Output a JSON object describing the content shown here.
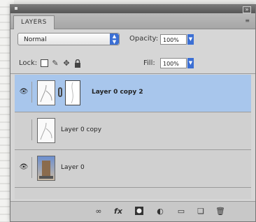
{
  "panel": {
    "tab_label": "LAYERS",
    "menu_icon": "panel-menu-icon"
  },
  "controls": {
    "blend_mode": "Normal",
    "opacity_label": "Opacity:",
    "opacity_value": "100%",
    "lock_label": "Lock:",
    "fill_label": "Fill:",
    "fill_value": "100%"
  },
  "layers": [
    {
      "name": "Layer 0 copy 2",
      "selected": true,
      "visible": true,
      "has_mask": true
    },
    {
      "name": "Layer 0 copy",
      "selected": false,
      "visible": false,
      "has_mask": false
    },
    {
      "name": "Layer 0",
      "selected": false,
      "visible": true,
      "has_mask": false
    }
  ],
  "bottom_icons": [
    "link-layers-icon",
    "fx-icon",
    "add-mask-icon",
    "adjustment-layer-icon",
    "new-group-icon",
    "new-layer-icon",
    "trash-icon"
  ],
  "colors": {
    "selected_row": "#a8c6ec",
    "accent_blue": "#3b6fd4",
    "panel_bg": "#d6d6d6"
  }
}
